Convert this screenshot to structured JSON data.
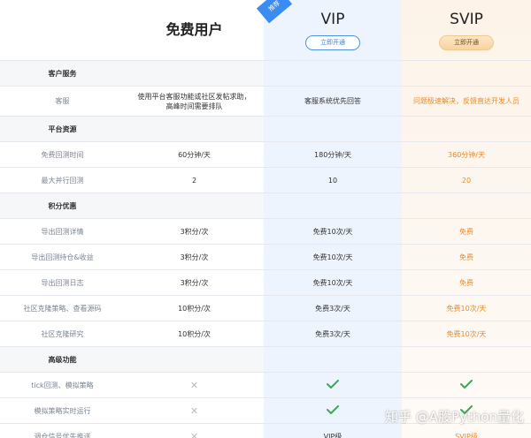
{
  "header": {
    "free_title": "免费用户",
    "vip_title": "VIP",
    "vip_button": "立即开通",
    "svip_title": "SVIP",
    "svip_button": "立即开通",
    "ribbon": "推荐"
  },
  "sections": [
    {
      "title": "客户服务",
      "rows": [
        {
          "feature": "客服",
          "free": "使用平台客服功能或社区发帖求助，高峰时间需要排队",
          "vip": "客服系统优先回答",
          "svip": "问题极速解决，反馈直达开发人员"
        }
      ]
    },
    {
      "title": "平台资源",
      "rows": [
        {
          "feature": "免费回测时间",
          "free": "60分钟/天",
          "vip": "180分钟/天",
          "svip": "360分钟/天"
        },
        {
          "feature": "最大并行回测",
          "free": "2",
          "vip": "10",
          "svip": "20"
        }
      ]
    },
    {
      "title": "积分优惠",
      "rows": [
        {
          "feature": "导出回测详情",
          "free": "3积分/次",
          "vip": "免费10次/天",
          "svip": "免费"
        },
        {
          "feature": "导出回测持仓&收益",
          "free": "3积分/次",
          "vip": "免费10次/天",
          "svip": "免费"
        },
        {
          "feature": "导出回测日志",
          "free": "3积分/次",
          "vip": "免费10次/天",
          "svip": "免费"
        },
        {
          "feature": "社区克隆策略、查看源码",
          "free": "10积分/次",
          "vip": "免费3次/天",
          "svip": "免费10次/天"
        },
        {
          "feature": "社区克隆研究",
          "free": "10积分/次",
          "vip": "免费3次/天",
          "svip": "免费10次/天"
        }
      ]
    },
    {
      "title": "高级功能",
      "rows": [
        {
          "feature": "tick回测、模拟策略",
          "free": "x",
          "vip": "check",
          "svip": "check"
        },
        {
          "feature": "模拟策略实时运行",
          "free": "x",
          "vip": "check",
          "svip": "check"
        },
        {
          "feature": "调仓信号优先推送",
          "free": "x",
          "vip": "VIP级",
          "svip": "SVIP级"
        }
      ]
    }
  ],
  "watermark": "知乎 @A股Python量化",
  "colors": {
    "vip_accent": "#3f7fd8",
    "svip_accent": "#e88b2c",
    "check": "#3aa858",
    "cross": "#b8bcc4"
  }
}
